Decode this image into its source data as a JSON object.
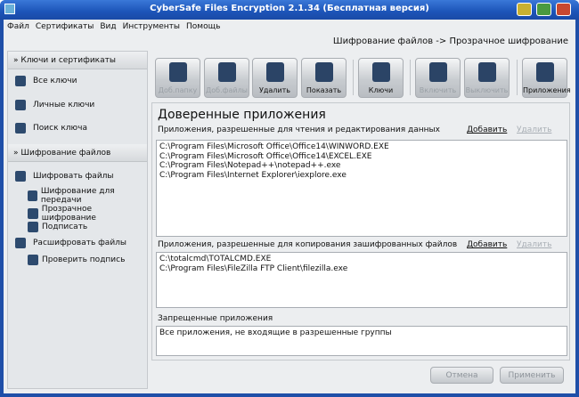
{
  "window": {
    "title": "CyberSafe Files Encryption 2.1.34 (Бесплатная версия)"
  },
  "menu": [
    "Файл",
    "Сертификаты",
    "Вид",
    "Инструменты",
    "Помощь"
  ],
  "breadcrumb": "Шифрование файлов -> Прозрачное шифрование",
  "sidebar": {
    "sections": [
      {
        "title": "Ключи и сертификаты",
        "items": [
          "Все ключи",
          "Личные ключи",
          "Поиск ключа"
        ]
      },
      {
        "title": "Шифрование файлов",
        "items": [
          "Шифровать файлы",
          "Шифрование для передачи",
          "Прозрачное шифрование",
          "Подписать",
          "Расшифровать файлы",
          "Проверить подпись"
        ]
      }
    ]
  },
  "toolbar": [
    {
      "label": "Доб.папку",
      "enabled": false
    },
    {
      "label": "Доб.файлы",
      "enabled": false
    },
    {
      "label": "Удалить",
      "enabled": true
    },
    {
      "label": "Показать",
      "enabled": true
    },
    {
      "label": "Ключи",
      "enabled": true
    },
    {
      "label": "Включить",
      "enabled": false
    },
    {
      "label": "Выключить",
      "enabled": false
    },
    {
      "label": "Приложения",
      "enabled": true
    }
  ],
  "main": {
    "title": "Доверенные приложения",
    "add": "Добавить",
    "remove": "Удалить",
    "group1": {
      "label": "Приложения, разрешенные для чтения и редактирования данных",
      "items": [
        "C:\\Program Files\\Microsoft Office\\Office14\\WINWORD.EXE",
        "C:\\Program Files\\Microsoft Office\\Office14\\EXCEL.EXE",
        "C:\\Program Files\\Notepad++\\notepad++.exe",
        "C:\\Program Files\\Internet Explorer\\iexplore.exe"
      ]
    },
    "group2": {
      "label": "Приложения, разрешенные для копирования зашифрованных файлов",
      "items": [
        "C:\\totalcmd\\TOTALCMD.EXE",
        "C:\\Program Files\\FileZilla FTP Client\\filezilla.exe"
      ]
    },
    "group3": {
      "label": "Запрещенные приложения",
      "items": [
        "Все приложения, не входящие в разрешенные группы"
      ]
    }
  },
  "buttons": {
    "cancel": "Отмена",
    "apply": "Применить"
  }
}
